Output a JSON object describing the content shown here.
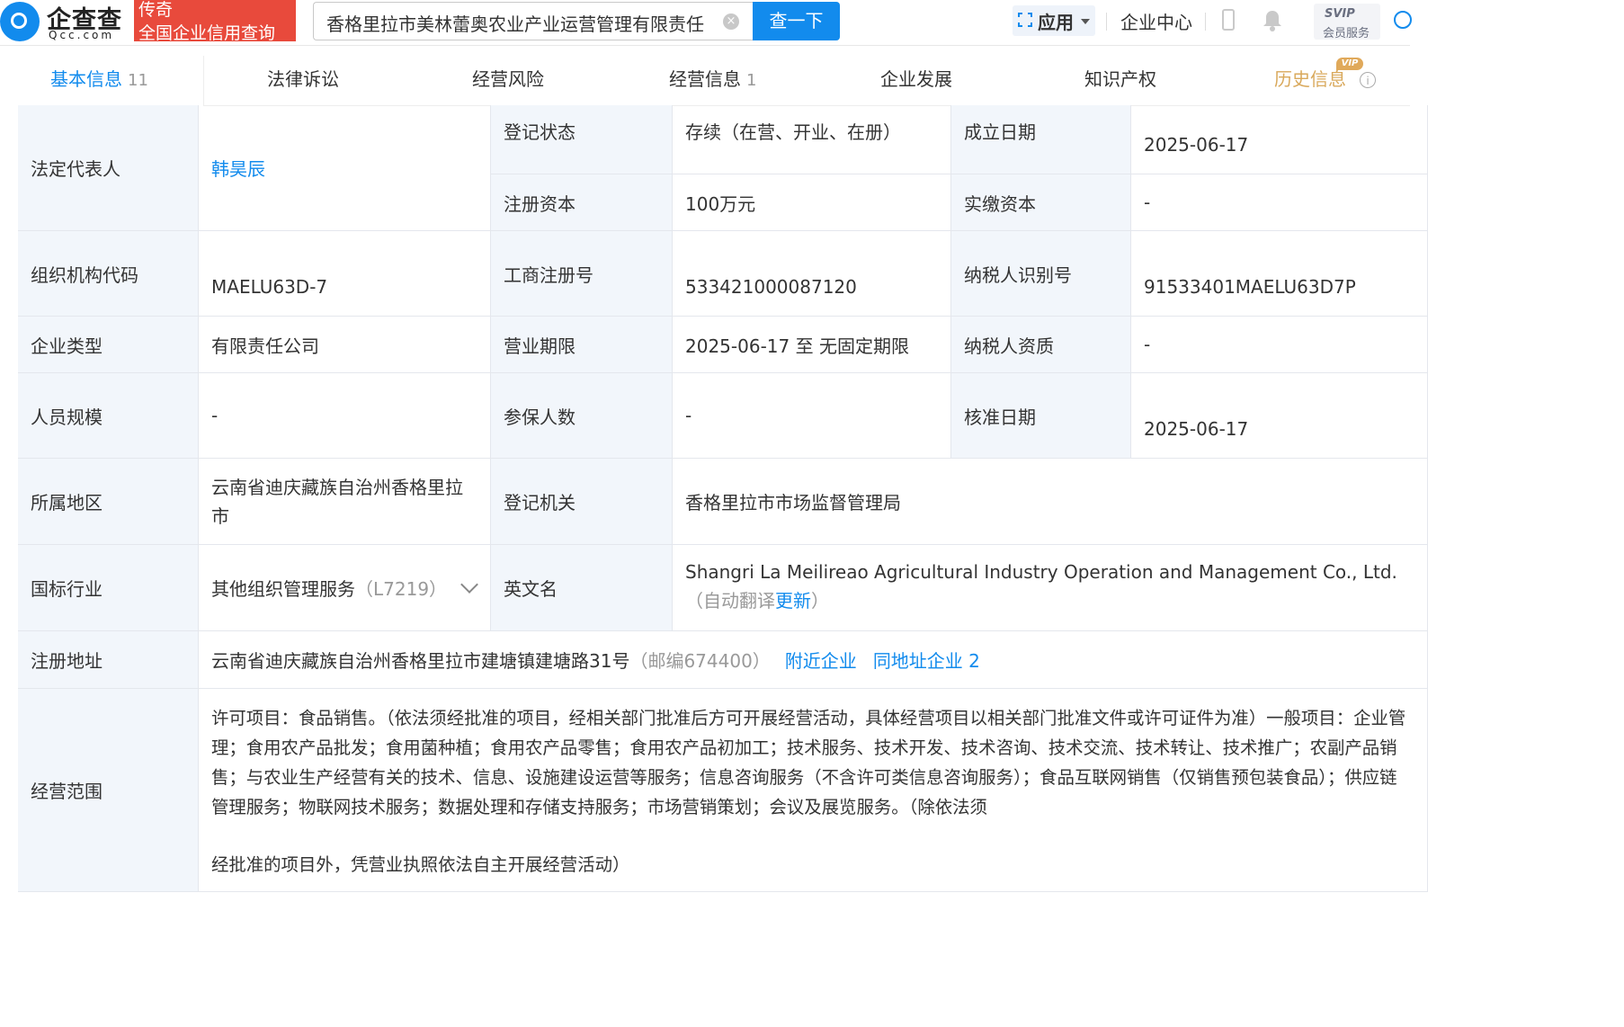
{
  "header": {
    "logo_cn": "企查查",
    "logo_en": "Qcc.com",
    "badge_line1": "传奇",
    "badge_line2": "全国企业信用查询",
    "search_value": "香格里拉市美林蕾奥农业产业运营管理有限责任",
    "search_button": "查一下",
    "app_menu": "应用",
    "enterprise_center": "企业中心",
    "svip_top": "SVIP",
    "svip_bottom": "会员服务"
  },
  "tabs": [
    {
      "label": "基本信息",
      "count": "11"
    },
    {
      "label": "法律诉讼"
    },
    {
      "label": "经营风险"
    },
    {
      "label": "经营信息",
      "count": "1"
    },
    {
      "label": "企业发展"
    },
    {
      "label": "知识产权"
    },
    {
      "label": "历史信息",
      "badge": "VIP"
    }
  ],
  "table": {
    "legal_rep_label": "法定代表人",
    "legal_rep_value": "韩昊辰",
    "reg_status_label": "登记状态",
    "reg_status_value": "存续（在营、开业、在册）",
    "found_date_label": "成立日期",
    "found_date_value": "2025-06-17",
    "reg_capital_label": "注册资本",
    "reg_capital_value": "100万元",
    "paid_capital_label": "实缴资本",
    "paid_capital_value": "-",
    "org_code_label": "组织机构代码",
    "org_code_value": "MAELU63D-7",
    "biz_reg_no_label": "工商注册号",
    "biz_reg_no_value": "533421000087120",
    "taxpayer_id_label": "纳税人识别号",
    "taxpayer_id_value": "91533401MAELU63D7P",
    "company_type_label": "企业类型",
    "company_type_value": "有限责任公司",
    "biz_term_label": "营业期限",
    "biz_term_value": "2025-06-17 至 无固定期限",
    "taxpayer_qual_label": "纳税人资质",
    "taxpayer_qual_value": "-",
    "staff_size_label": "人员规模",
    "staff_size_value": "-",
    "insured_label": "参保人数",
    "insured_value": "-",
    "approval_date_label": "核准日期",
    "approval_date_value": "2025-06-17",
    "region_label": "所属地区",
    "region_value": "云南省迪庆藏族自治州香格里拉市",
    "reg_authority_label": "登记机关",
    "reg_authority_value": "香格里拉市市场监督管理局",
    "industry_label": "国标行业",
    "industry_value": "其他组织管理服务",
    "industry_code": "（L7219）",
    "english_name_label": "英文名",
    "english_name_value": "Shangri La Meilireao Agricultural Industry Operation and Management Co., Ltd.",
    "english_name_note_open": "（自动翻译",
    "english_name_update": "更新",
    "english_name_note_close": "）",
    "address_label": "注册地址",
    "address_value": "云南省迪庆藏族自治州香格里拉市建塘镇建塘路31号",
    "postcode": "（邮编674400）",
    "nearby_link": "附近企业",
    "same_address_link": "同地址企业 2",
    "scope_label": "经营范围",
    "scope_value": "许可项目：食品销售。（依法须经批准的项目，经相关部门批准后方可开展经营活动，具体经营项目以相关部门批准文件或许可证件为准）一般项目：企业管理；食用农产品批发；食用菌种植；食用农产品零售；食用农产品初加工；技术服务、技术开发、技术咨询、技术交流、技术转让、技术推广；农副产品销售；与农业生产经营有关的技术、信息、设施建设运营等服务；信息咨询服务（不含许可类信息咨询服务）；食品互联网销售（仅销售预包装食品）；供应链管理服务；物联网技术服务；数据处理和存储支持服务；市场营销策划；会议及展览服务。（除依法须",
    "scope_value_tail": "经批准的项目外，凭营业执照依法自主开展经营活动）"
  }
}
